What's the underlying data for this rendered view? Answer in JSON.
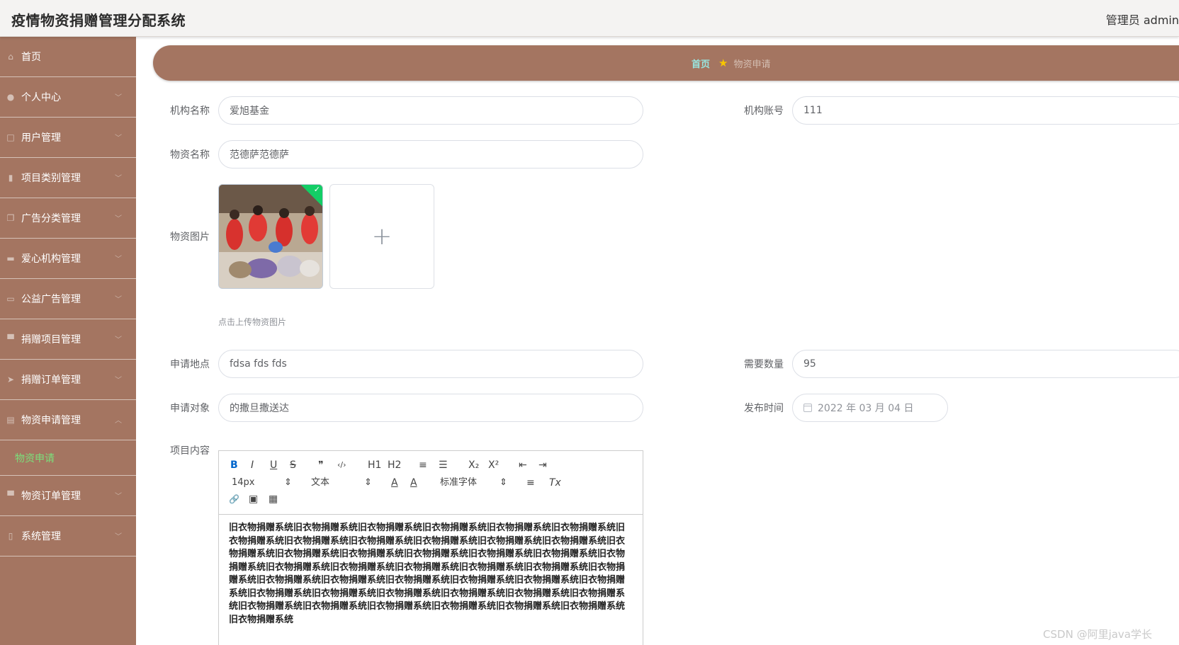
{
  "header": {
    "title": "疫情物资捐赠管理分配系统",
    "admin": "管理员 admin"
  },
  "sidebar": {
    "items": [
      {
        "label": "首页",
        "icon": "home-icon",
        "expandable": false
      },
      {
        "label": "个人中心",
        "icon": "user-icon",
        "expandable": true
      },
      {
        "label": "用户管理",
        "icon": "users-icon",
        "expandable": true
      },
      {
        "label": "项目类别管理",
        "icon": "bar-chart-icon",
        "expandable": true
      },
      {
        "label": "广告分类管理",
        "icon": "copy-icon",
        "expandable": true
      },
      {
        "label": "爱心机构管理",
        "icon": "building-icon",
        "expandable": true
      },
      {
        "label": "公益广告管理",
        "icon": "image-icon",
        "expandable": true
      },
      {
        "label": "捐赠项目管理",
        "icon": "monitor-icon",
        "expandable": true
      },
      {
        "label": "捐赠订单管理",
        "icon": "send-icon",
        "expandable": true
      },
      {
        "label": "物资申请管理",
        "icon": "document-icon",
        "expandable": true,
        "expanded": true,
        "sub": [
          "物资申请"
        ]
      },
      {
        "label": "物资订单管理",
        "icon": "chat-icon",
        "expandable": true
      },
      {
        "label": "系统管理",
        "icon": "phone-icon",
        "expandable": true
      }
    ]
  },
  "breadcrumb": {
    "home": "首页",
    "current": "物资申请"
  },
  "form": {
    "org_name": {
      "label": "机构名称",
      "value": "爱旭基金"
    },
    "org_account": {
      "label": "机构账号",
      "value": "111"
    },
    "item_name": {
      "label": "物资名称",
      "value": "范德萨范德萨"
    },
    "item_image": {
      "label": "物资图片",
      "hint": "点击上传物资图片"
    },
    "location": {
      "label": "申请地点",
      "value": "fdsa fds fds"
    },
    "quantity": {
      "label": "需要数量",
      "value": "95"
    },
    "target": {
      "label": "申请对象",
      "value": "的撒旦撒送达"
    },
    "publish_time": {
      "label": "发布时间",
      "value": "2022 年 03 月 04 日"
    },
    "content": {
      "label": "项目内容",
      "toolbar": {
        "bold": "B",
        "italic": "I",
        "underline": "U",
        "strike": "S",
        "quote": "❞",
        "code": "‹/›",
        "h1": "H1",
        "h2": "H2",
        "ordered": "≡",
        "bullet": "☰",
        "sub": "X₂",
        "sup": "X²",
        "outdent": "⇤",
        "indent": "⇥",
        "size": "14px",
        "format": "文本",
        "color": "A",
        "bg": "A",
        "font": "标准字体",
        "align": "≡",
        "clean": "Tx",
        "link": "🔗",
        "image": "▣",
        "video": "▦"
      },
      "text": "旧衣物捐赠系统旧衣物捐赠系统旧衣物捐赠系统旧衣物捐赠系统旧衣物捐赠系统旧衣物捐赠系统旧衣物捐赠系统旧衣物捐赠系统旧衣物捐赠系统旧衣物捐赠系统旧衣物捐赠系统旧衣物捐赠系统旧衣物捐赠系统旧衣物捐赠系统旧衣物捐赠系统旧衣物捐赠系统旧衣物捐赠系统旧衣物捐赠系统旧衣物捐赠系统旧衣物捐赠系统旧衣物捐赠系统旧衣物捐赠系统旧衣物捐赠系统旧衣物捐赠系统旧衣物捐赠系统旧衣物捐赠系统旧衣物捐赠系统旧衣物捐赠系统旧衣物捐赠系统旧衣物捐赠系统旧衣物捐赠系统旧衣物捐赠系统旧衣物捐赠系统旧衣物捐赠系统旧衣物捐赠系统旧衣物捐赠系统旧衣物捐赠系统旧衣物捐赠系统旧衣物捐赠系统旧衣物捐赠系统旧衣物捐赠系统旧衣物捐赠系统旧衣物捐赠系统旧衣物捐赠系统"
    }
  },
  "watermark": "CSDN @阿里java学长",
  "colors": {
    "sidebar": "#a47561",
    "header": "#f4f3f2",
    "crumb_home": "#98e6e0",
    "sub_active": "#7be07b"
  }
}
